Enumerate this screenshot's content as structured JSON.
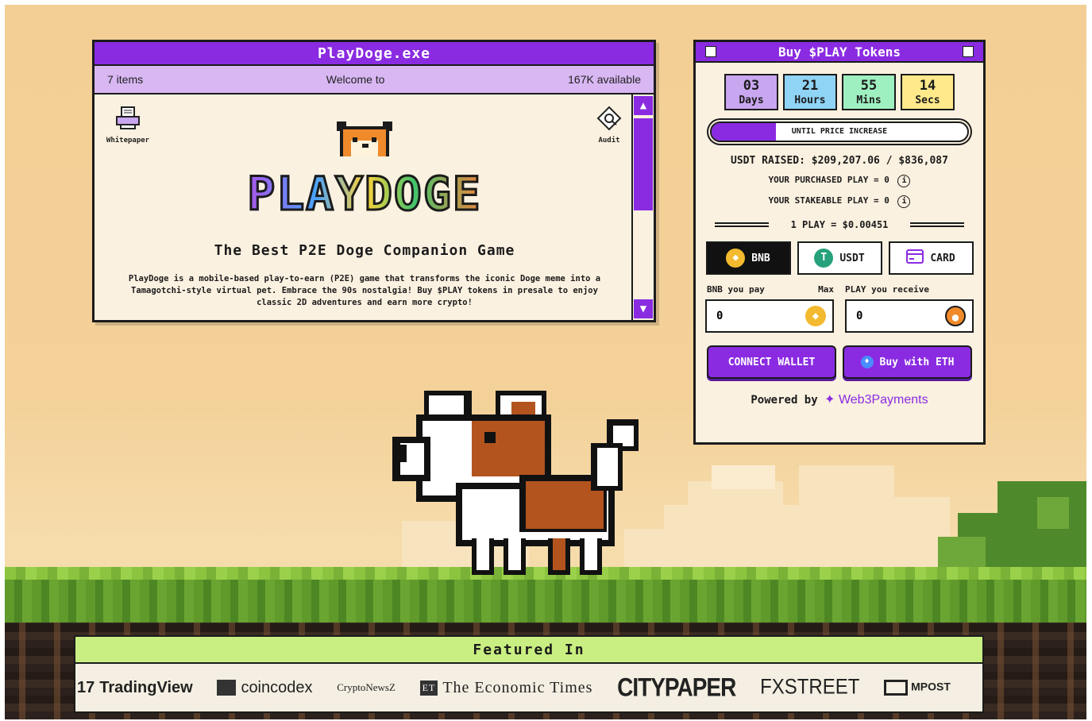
{
  "window": {
    "title": "PlayDoge.exe",
    "items_count": "7 items",
    "welcome": "Welcome to",
    "available": "167K available",
    "icons": [
      {
        "label": "Whitepaper",
        "icon": "printer-icon"
      },
      {
        "label": "Audit",
        "icon": "audit-icon"
      }
    ],
    "logo_text": "PLAYDOGE",
    "tagline": "The Best P2E Doge Companion Game",
    "description": "PlayDoge is a mobile-based play-to-earn (P2E) game that transforms the iconic Doge meme into a Tamagotchi-style virtual pet. Embrace the 90s nostalgia! Buy $PLAY tokens in presale to enjoy classic 2D adventures and earn more crypto!"
  },
  "buy_widget": {
    "title": "Buy $PLAY Tokens",
    "countdown": [
      {
        "value": "03",
        "label": "Days",
        "color": "#c9a6f0"
      },
      {
        "value": "21",
        "label": "Hours",
        "color": "#8fd3f5"
      },
      {
        "value": "55",
        "label": "Mins",
        "color": "#9ff0c0"
      },
      {
        "value": "14",
        "label": "Secs",
        "color": "#ffe98a"
      }
    ],
    "progress_label": "UNTIL PRICE INCREASE",
    "progress_fraction": 0.25,
    "usdt_raised": "USDT RAISED: $209,207.06 / $836,087",
    "purchased": "YOUR PURCHASED PLAY = 0",
    "stakeable": "YOUR STAKEABLE PLAY = 0",
    "rate": "1 PLAY = $0.00451",
    "payment_methods": [
      {
        "label": "BNB",
        "icon": "bnb-icon",
        "active": true
      },
      {
        "label": "USDT",
        "icon": "usdt-icon",
        "active": false
      },
      {
        "label": "CARD",
        "icon": "card-icon",
        "active": false
      }
    ],
    "pay_label": "BNB you pay",
    "max_label": "Max",
    "receive_label": "PLAY you receive",
    "pay_value": "0",
    "receive_value": "0",
    "connect_wallet": "CONNECT WALLET",
    "buy_eth": "Buy with ETH",
    "powered_by": "Powered by",
    "powered_brand": "Web3Payments"
  },
  "featured": {
    "title": "Featured In",
    "brands": [
      "TradingView",
      "coincodex",
      "CryptoNewsZ",
      "The Economic Times",
      "CITYPAPER",
      "FXSTREET",
      "MPOST"
    ]
  },
  "colors": {
    "purple": "#8a2be2",
    "lavender": "#d8b7f3",
    "cream": "#fbf1e0",
    "lime": "#c9ef82"
  }
}
